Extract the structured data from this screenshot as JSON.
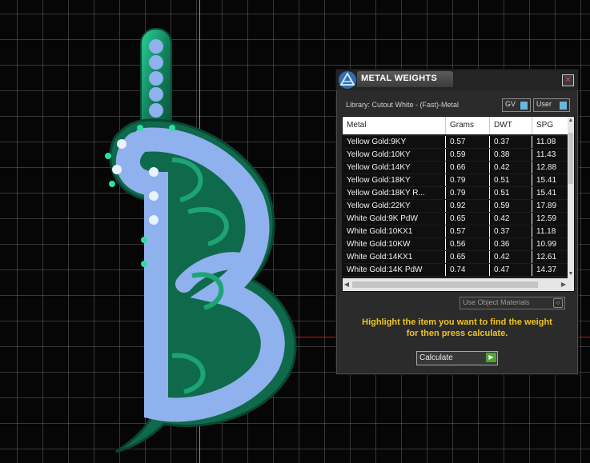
{
  "window": {
    "title": "METAL WEIGHTS",
    "close_icon": "close-icon"
  },
  "library": {
    "label": "Library: Cutout White - (Fast)-Metal",
    "gv_label": "GV",
    "user_label": "User"
  },
  "table": {
    "columns": [
      "Metal",
      "Grams",
      "DWT",
      "SPG"
    ],
    "rows": [
      [
        "Yellow Gold:9KY",
        "0.57",
        "0.37",
        "11.08"
      ],
      [
        "Yellow Gold:10KY",
        "0.59",
        "0.38",
        "11.43"
      ],
      [
        "Yellow Gold:14KY",
        "0.66",
        "0.42",
        "12.88"
      ],
      [
        "Yellow Gold:18KY",
        "0.79",
        "0.51",
        "15.41"
      ],
      [
        "Yellow Gold:18KY R...",
        "0.79",
        "0.51",
        "15.41"
      ],
      [
        "Yellow Gold:22KY",
        "0.92",
        "0.59",
        "17.89"
      ],
      [
        "White Gold:9K PdW",
        "0.65",
        "0.42",
        "12.59"
      ],
      [
        "White Gold:10KX1",
        "0.57",
        "0.37",
        "11.18"
      ],
      [
        "White Gold:10KW",
        "0.56",
        "0.36",
        "10.99"
      ],
      [
        "White Gold:14KX1",
        "0.65",
        "0.42",
        "12.61"
      ],
      [
        "White Gold:14K PdW",
        "0.74",
        "0.47",
        "14.37"
      ]
    ]
  },
  "options": {
    "use_object_materials": "Use Object Materials"
  },
  "instruction": {
    "line1": "Highlight the item you want to find the weight",
    "line2": "for then press calculate."
  },
  "calculate_label": "Calculate",
  "colors": {
    "instruction_text": "#f0c420",
    "metal_green": "#137a57",
    "gem_blue": "#8fb1ee",
    "accent_green_button": "#4aa52e"
  }
}
